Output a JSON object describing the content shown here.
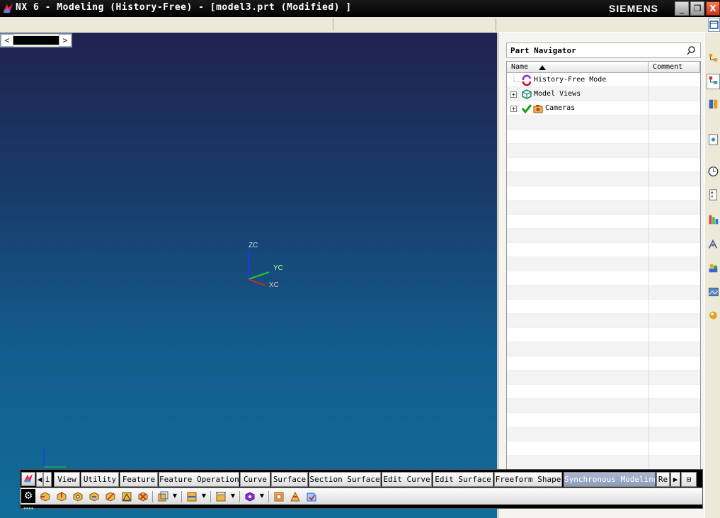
{
  "window": {
    "title": "NX 6 - Modeling (History-Free) - [model3.prt (Modified) ]",
    "brand": "SIEMENS",
    "minimize": "_",
    "restore": "❐",
    "close": "X"
  },
  "viewport": {
    "scroll_left": "<",
    "scroll_right": ">",
    "axes": {
      "z": "ZC",
      "y": "YC",
      "x": "XC"
    },
    "axis_colors": {
      "z": "#2233ff",
      "y": "#22cc22",
      "x": "#dd2222"
    }
  },
  "part_navigator": {
    "title": "Part Navigator",
    "columns": {
      "name": "Name",
      "comment": "Comment"
    },
    "items": [
      {
        "label": "History-Free Mode",
        "icon": "history-free-icon"
      },
      {
        "label": "Model Views",
        "icon": "model-views-icon",
        "expand": "+"
      },
      {
        "label": "Cameras",
        "icon": "cameras-icon",
        "expand": "+"
      }
    ]
  },
  "ribbon": {
    "tabs": [
      {
        "label": "◀",
        "name": "tab-scroll-left"
      },
      {
        "label": "i",
        "name": "tab-partial"
      },
      {
        "label": "View",
        "name": "tab-view"
      },
      {
        "label": "Utility",
        "name": "tab-utility"
      },
      {
        "label": "Feature",
        "name": "tab-feature"
      },
      {
        "label": "Feature Operation",
        "name": "tab-feature-operation"
      },
      {
        "label": "Curve",
        "name": "tab-curve"
      },
      {
        "label": "Surface",
        "name": "tab-surface"
      },
      {
        "label": "Section Surface",
        "name": "tab-section-surface"
      },
      {
        "label": "Edit Curve",
        "name": "tab-edit-curve"
      },
      {
        "label": "Edit Surface",
        "name": "tab-edit-surface"
      },
      {
        "label": "Freeform Shape",
        "name": "tab-freeform-shape"
      },
      {
        "label": "Synchronous Modeling",
        "name": "tab-synchronous-modeling"
      },
      {
        "label": "Re",
        "name": "tab-re"
      },
      {
        "label": "▶",
        "name": "tab-scroll-right"
      },
      {
        "label": "⊟",
        "name": "tab-menu"
      }
    ],
    "active_tab": "Synchronous Modeling"
  }
}
